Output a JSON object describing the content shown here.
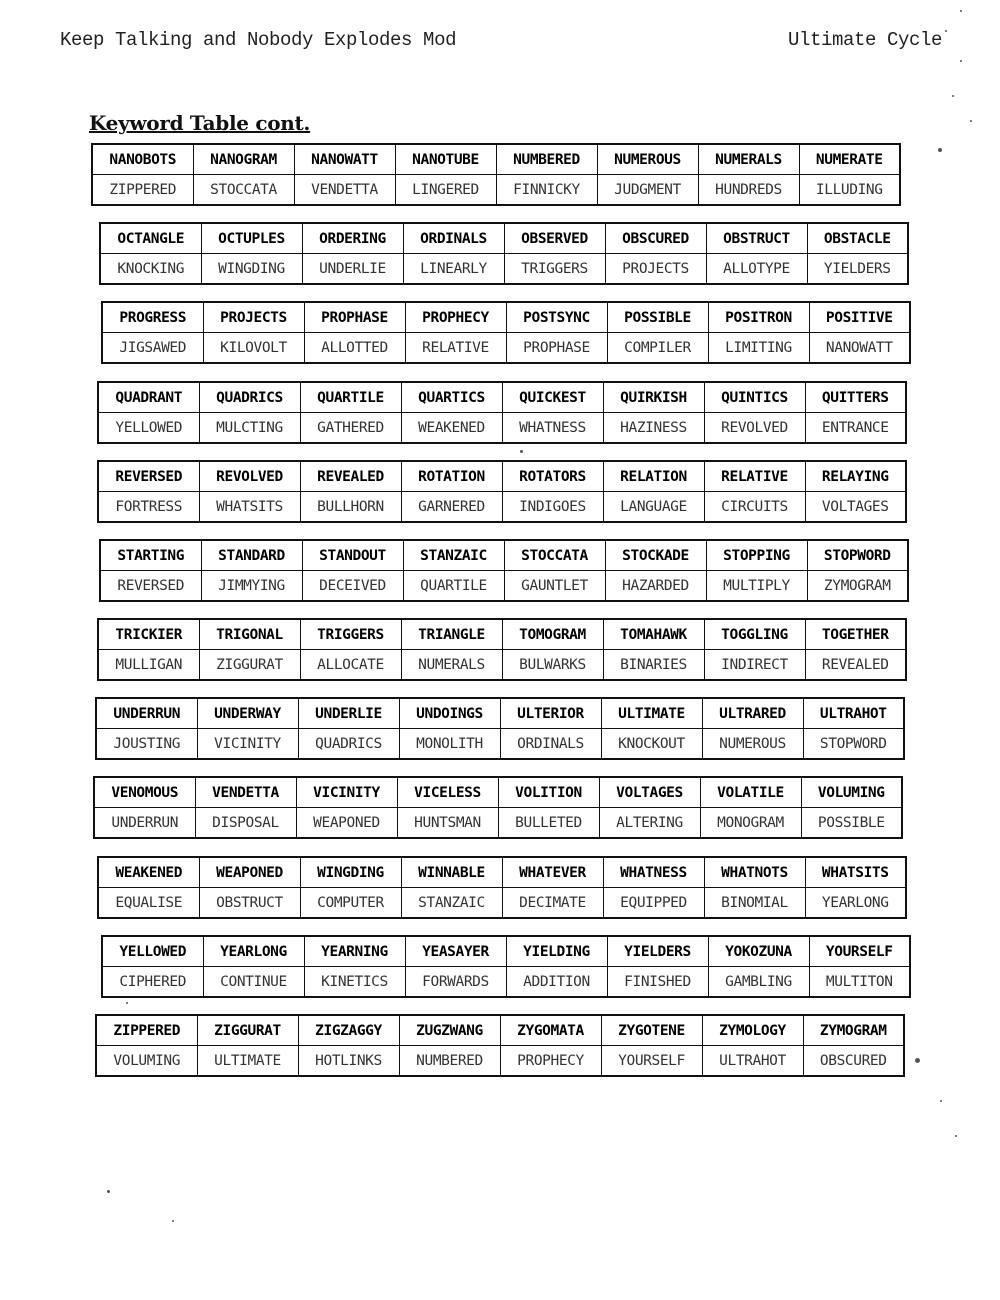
{
  "header": {
    "left": "Keep Talking and Nobody Explodes Mod",
    "right": "Ultimate Cycle"
  },
  "section_title": "Keyword Table cont.",
  "tables": [
    {
      "keys": [
        "NANOBOTS",
        "NANOGRAM",
        "NANOWATT",
        "NANOTUBE",
        "NUMBERED",
        "NUMEROUS",
        "NUMERALS",
        "NUMERATE"
      ],
      "values": [
        "ZIPPERED",
        "STOCCATA",
        "VENDETTA",
        "LINGERED",
        "FINNICKY",
        "JUDGMENT",
        "HUNDREDS",
        "ILLUDING"
      ]
    },
    {
      "keys": [
        "OCTANGLE",
        "OCTUPLES",
        "ORDERING",
        "ORDINALS",
        "OBSERVED",
        "OBSCURED",
        "OBSTRUCT",
        "OBSTACLE"
      ],
      "values": [
        "KNOCKING",
        "WINGDING",
        "UNDERLIE",
        "LINEARLY",
        "TRIGGERS",
        "PROJECTS",
        "ALLOTYPE",
        "YIELDERS"
      ]
    },
    {
      "keys": [
        "PROGRESS",
        "PROJECTS",
        "PROPHASE",
        "PROPHECY",
        "POSTSYNC",
        "POSSIBLE",
        "POSITRON",
        "POSITIVE"
      ],
      "values": [
        "JIGSAWED",
        "KILOVOLT",
        "ALLOTTED",
        "RELATIVE",
        "PROPHASE",
        "COMPILER",
        "LIMITING",
        "NANOWATT"
      ]
    },
    {
      "keys": [
        "QUADRANT",
        "QUADRICS",
        "QUARTILE",
        "QUARTICS",
        "QUICKEST",
        "QUIRKISH",
        "QUINTICS",
        "QUITTERS"
      ],
      "values": [
        "YELLOWED",
        "MULCTING",
        "GATHERED",
        "WEAKENED",
        "WHATNESS",
        "HAZINESS",
        "REVOLVED",
        "ENTRANCE"
      ]
    },
    {
      "keys": [
        "REVERSED",
        "REVOLVED",
        "REVEALED",
        "ROTATION",
        "ROTATORS",
        "RELATION",
        "RELATIVE",
        "RELAYING"
      ],
      "values": [
        "FORTRESS",
        "WHATSITS",
        "BULLHORN",
        "GARNERED",
        "INDIGOES",
        "LANGUAGE",
        "CIRCUITS",
        "VOLTAGES"
      ]
    },
    {
      "keys": [
        "STARTING",
        "STANDARD",
        "STANDOUT",
        "STANZAIC",
        "STOCCATA",
        "STOCKADE",
        "STOPPING",
        "STOPWORD"
      ],
      "values": [
        "REVERSED",
        "JIMMYING",
        "DECEIVED",
        "QUARTILE",
        "GAUNTLET",
        "HAZARDED",
        "MULTIPLY",
        "ZYMOGRAM"
      ]
    },
    {
      "keys": [
        "TRICKIER",
        "TRIGONAL",
        "TRIGGERS",
        "TRIANGLE",
        "TOMOGRAM",
        "TOMAHAWK",
        "TOGGLING",
        "TOGETHER"
      ],
      "values": [
        "MULLIGAN",
        "ZIGGURAT",
        "ALLOCATE",
        "NUMERALS",
        "BULWARKS",
        "BINARIES",
        "INDIRECT",
        "REVEALED"
      ]
    },
    {
      "keys": [
        "UNDERRUN",
        "UNDERWAY",
        "UNDERLIE",
        "UNDOINGS",
        "ULTERIOR",
        "ULTIMATE",
        "ULTRARED",
        "ULTRAHOT"
      ],
      "values": [
        "JOUSTING",
        "VICINITY",
        "QUADRICS",
        "MONOLITH",
        "ORDINALS",
        "KNOCKOUT",
        "NUMEROUS",
        "STOPWORD"
      ]
    },
    {
      "keys": [
        "VENOMOUS",
        "VENDETTA",
        "VICINITY",
        "VICELESS",
        "VOLITION",
        "VOLTAGES",
        "VOLATILE",
        "VOLUMING"
      ],
      "values": [
        "UNDERRUN",
        "DISPOSAL",
        "WEAPONED",
        "HUNTSMAN",
        "BULLETED",
        "ALTERING",
        "MONOGRAM",
        "POSSIBLE"
      ]
    },
    {
      "keys": [
        "WEAKENED",
        "WEAPONED",
        "WINGDING",
        "WINNABLE",
        "WHATEVER",
        "WHATNESS",
        "WHATNOTS",
        "WHATSITS"
      ],
      "values": [
        "EQUALISE",
        "OBSTRUCT",
        "COMPUTER",
        "STANZAIC",
        "DECIMATE",
        "EQUIPPED",
        "BINOMIAL",
        "YEARLONG"
      ]
    },
    {
      "keys": [
        "YELLOWED",
        "YEARLONG",
        "YEARNING",
        "YEASAYER",
        "YIELDING",
        "YIELDERS",
        "YOKOZUNA",
        "YOURSELF"
      ],
      "values": [
        "CIPHERED",
        "CONTINUE",
        "KINETICS",
        "FORWARDS",
        "ADDITION",
        "FINISHED",
        "GAMBLING",
        "MULTITON"
      ]
    },
    {
      "keys": [
        "ZIPPERED",
        "ZIGGURAT",
        "ZIGZAGGY",
        "ZUGZWANG",
        "ZYGOMATA",
        "ZYGOTENE",
        "ZYMOLOGY",
        "ZYMOGRAM"
      ],
      "values": [
        "VOLUMING",
        "ULTIMATE",
        "HOTLINKS",
        "NUMBERED",
        "PROPHECY",
        "YOURSELF",
        "ULTRAHOT",
        "OBSCURED"
      ]
    }
  ]
}
